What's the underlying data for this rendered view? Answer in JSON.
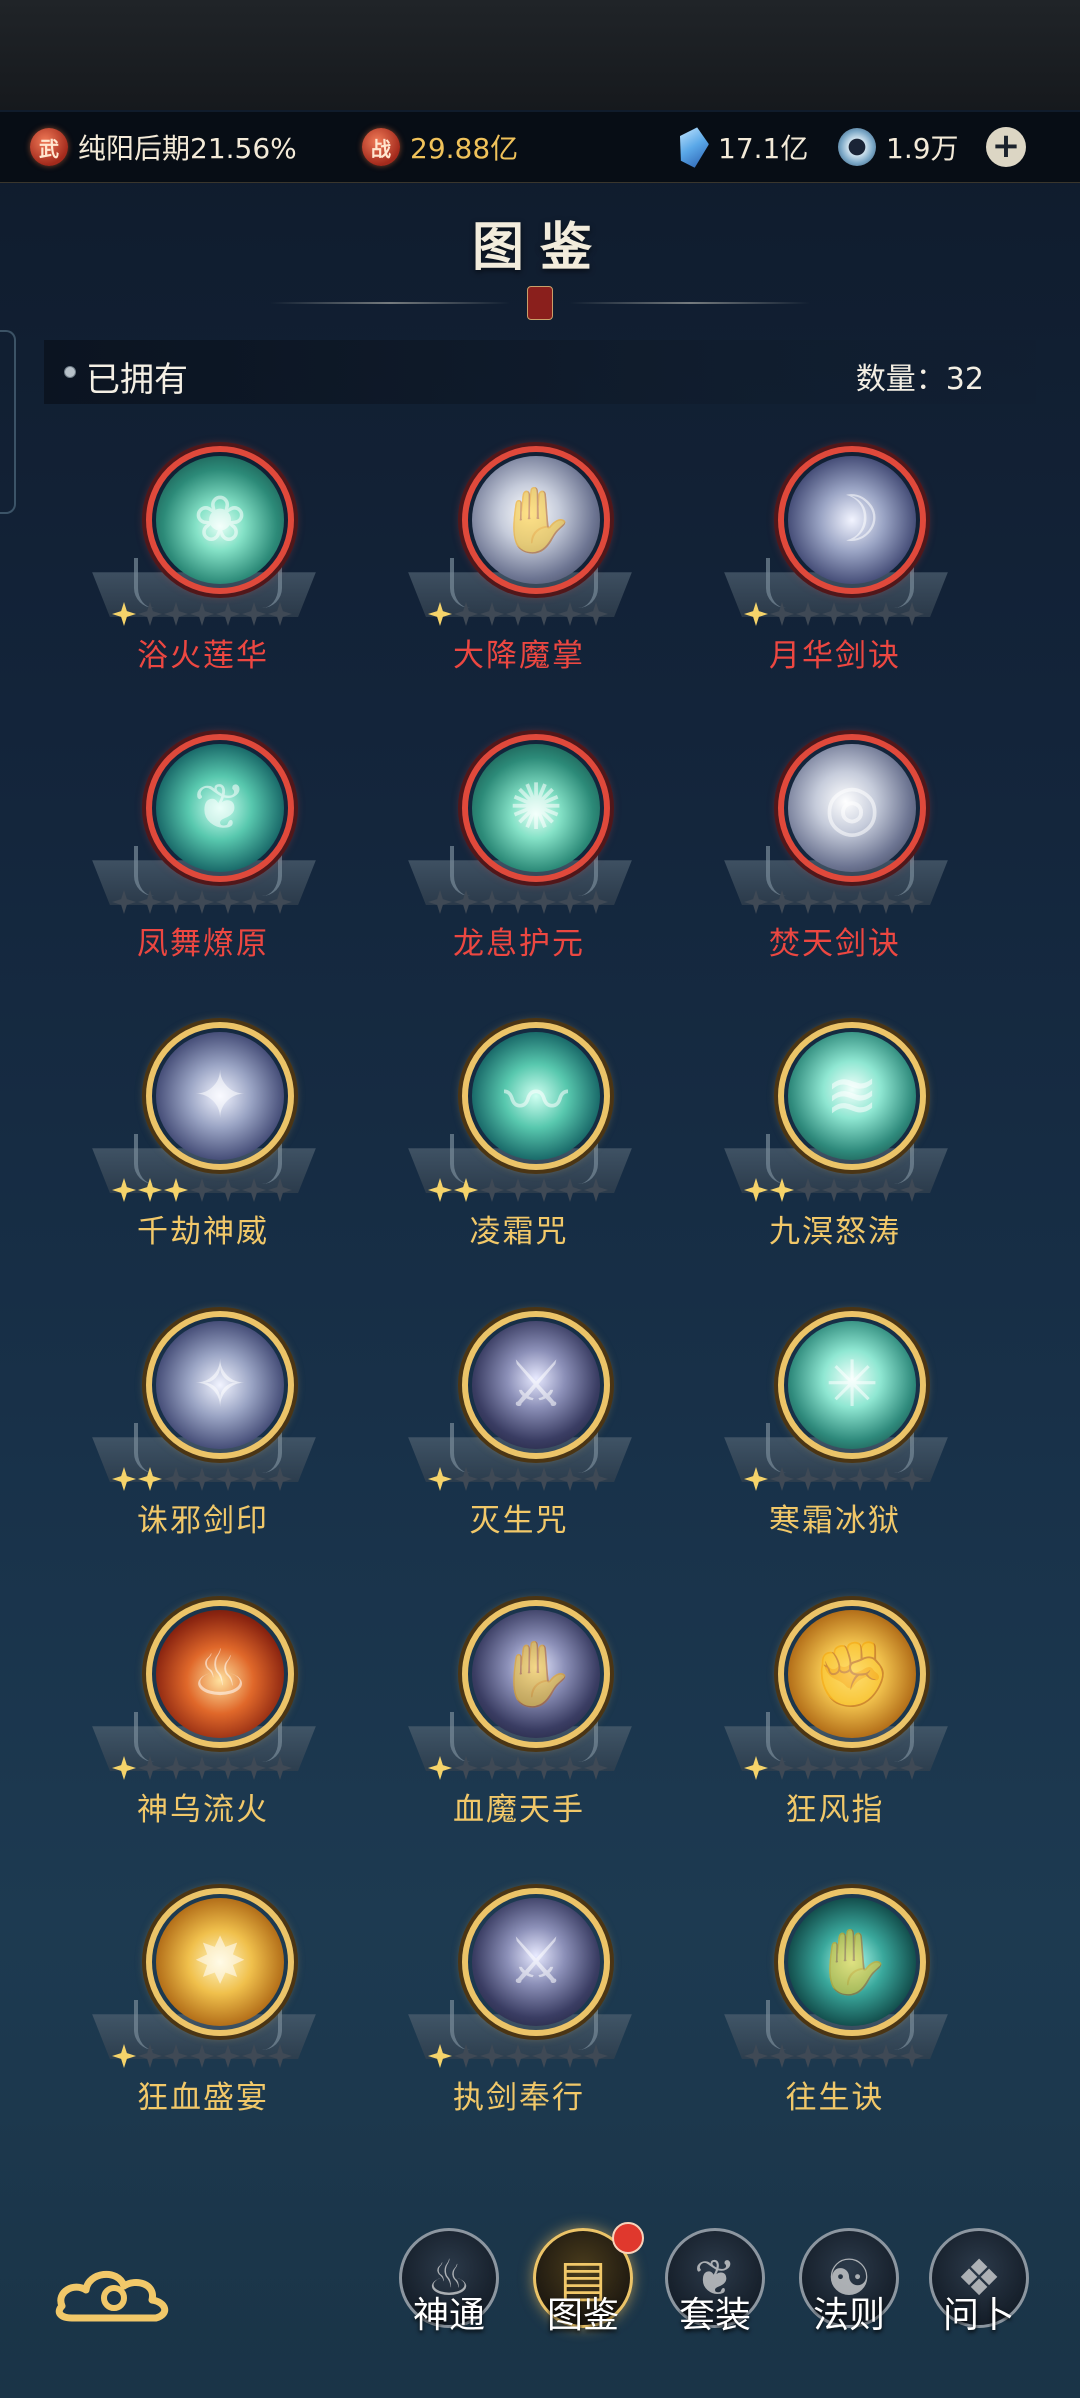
{
  "resources": {
    "realm_badge": "武",
    "realm_text": "纯阳后期21.56%",
    "power_badge": "战",
    "power_text": "29.88亿",
    "crystal_value": "17.1亿",
    "swirl_value": "1.9万",
    "plus_icon": "plus-icon"
  },
  "header": {
    "title": "图鉴"
  },
  "owned": {
    "label": "已拥有",
    "count_label": "数量：32"
  },
  "skills": [
    {
      "name": "浴火莲华",
      "stars": 1,
      "rarity": "red",
      "icon": "lotus-icon"
    },
    {
      "name": "大降魔掌",
      "stars": 1,
      "rarity": "red",
      "icon": "palm-icon"
    },
    {
      "name": "月华剑诀",
      "stars": 1,
      "rarity": "red",
      "icon": "moon-sword-icon"
    },
    {
      "name": "凤舞燎原",
      "stars": 0,
      "rarity": "red",
      "icon": "phoenix-icon"
    },
    {
      "name": "龙息护元",
      "stars": 0,
      "rarity": "red",
      "icon": "dragon-breath-icon"
    },
    {
      "name": "焚天剑诀",
      "stars": 0,
      "rarity": "red",
      "icon": "blade-swirl-icon"
    },
    {
      "name": "千劫神威",
      "stars": 3,
      "rarity": "gold",
      "icon": "whirlwind-icon"
    },
    {
      "name": "凌霜咒",
      "stars": 2,
      "rarity": "gold",
      "icon": "frost-dragon-icon"
    },
    {
      "name": "九溟怒涛",
      "stars": 2,
      "rarity": "gold",
      "icon": "wave-icon"
    },
    {
      "name": "诛邪剑印",
      "stars": 2,
      "rarity": "gold",
      "icon": "tornado-icon"
    },
    {
      "name": "灭生咒",
      "stars": 1,
      "rarity": "gold",
      "icon": "slash-icon"
    },
    {
      "name": "寒霜冰狱",
      "stars": 1,
      "rarity": "gold",
      "icon": "ice-star-icon"
    },
    {
      "name": "神乌流火",
      "stars": 1,
      "rarity": "gold",
      "icon": "fire-rock-icon"
    },
    {
      "name": "血魔天手",
      "stars": 1,
      "rarity": "gold",
      "icon": "claw-icon"
    },
    {
      "name": "狂风指",
      "stars": 1,
      "rarity": "gold",
      "icon": "fist-icon"
    },
    {
      "name": "狂血盛宴",
      "stars": 1,
      "rarity": "gold",
      "icon": "golden-burst-icon"
    },
    {
      "name": "执剑奉行",
      "stars": 1,
      "rarity": "gold",
      "icon": "sword-hand-icon"
    },
    {
      "name": "往生诀",
      "stars": 0,
      "rarity": "gold",
      "icon": "spirit-hand-icon"
    }
  ],
  "bottom_nav": [
    {
      "label": "神通",
      "icon": "flame-spirit-icon",
      "active": false
    },
    {
      "label": "图鉴",
      "icon": "book-icon",
      "active": true,
      "badge": true
    },
    {
      "label": "套装",
      "icon": "fan-icon",
      "active": false
    },
    {
      "label": "法则",
      "icon": "mask-icon",
      "active": false
    },
    {
      "label": "问卜",
      "icon": "divination-icon",
      "active": false
    }
  ],
  "colors": {
    "red_rarity": "#ec4741",
    "gold_rarity": "#f1c869",
    "star_on": "#f5d36a",
    "badge_red": "#e0382d"
  }
}
